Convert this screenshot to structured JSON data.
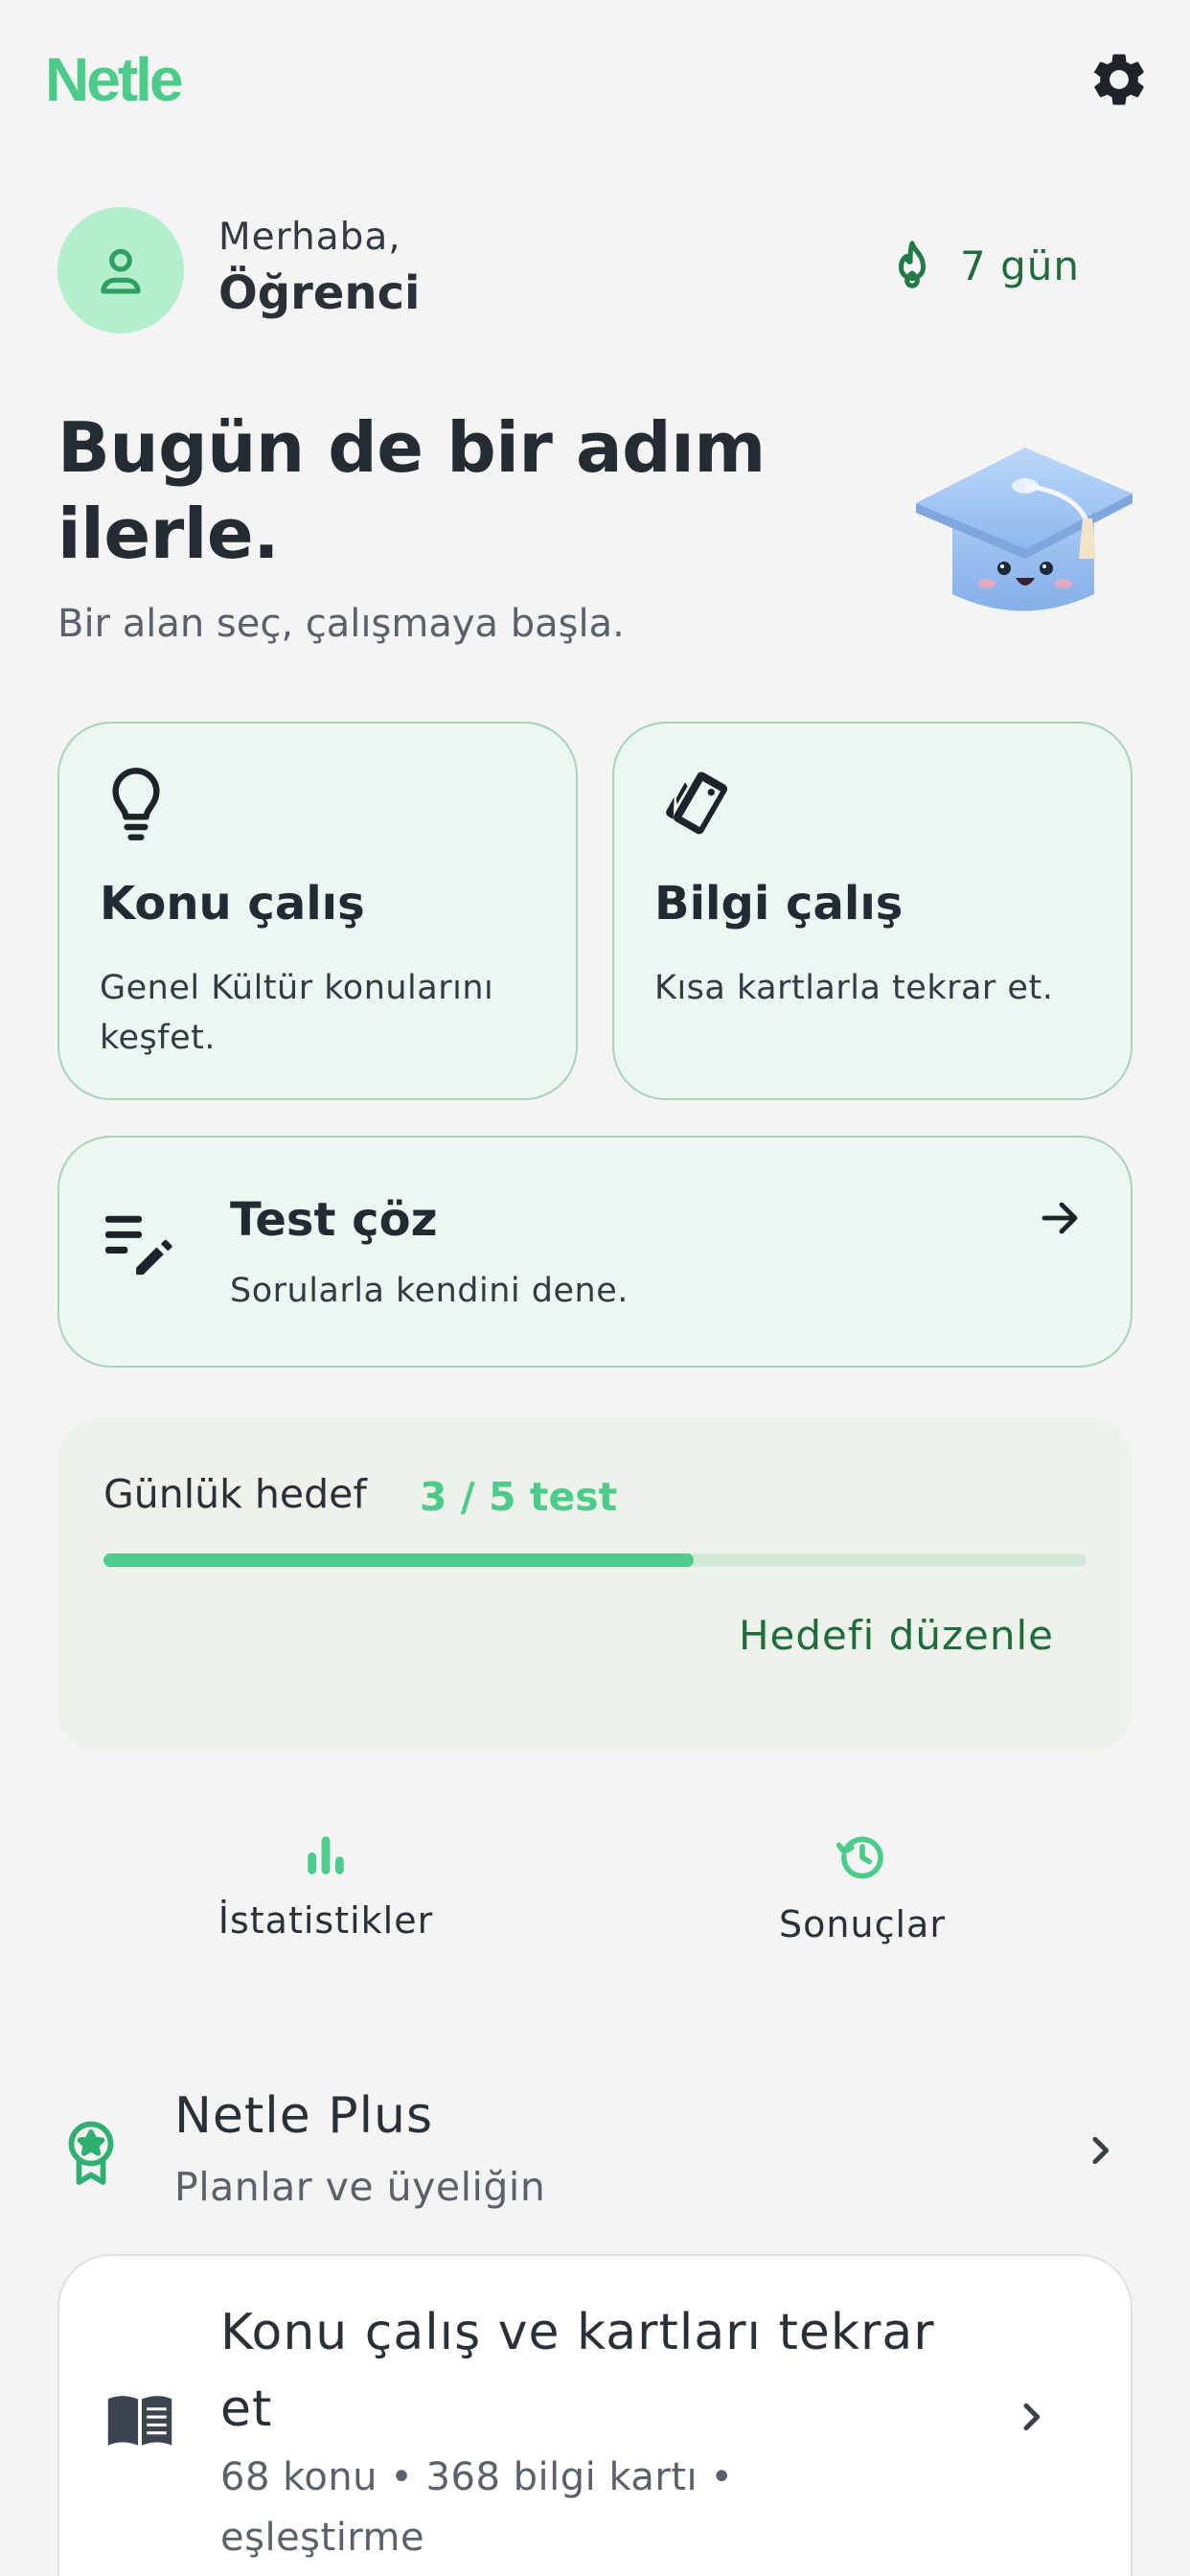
{
  "header": {
    "logo": "Netle",
    "settings_icon": "gear-icon"
  },
  "user": {
    "greeting": "Merhaba,",
    "name": "Öğrenci",
    "avatar_icon": "person-icon"
  },
  "streak": {
    "icon": "flame-icon",
    "label": "7 gün"
  },
  "hero": {
    "headline": "Bugün de bir adım ilerle.",
    "subtitle": "Bir alan seç, çalışmaya başla.",
    "mascot": "graduation-cap-mascot"
  },
  "cards": {
    "konu": {
      "icon": "lightbulb-icon",
      "title": "Konu çalış",
      "desc": "Genel Kültür konularını keşfet."
    },
    "bilgi": {
      "icon": "flashcards-icon",
      "title": "Bilgi çalış",
      "desc": "Kısa kartlarla tekrar et."
    },
    "test": {
      "icon": "edit-list-icon",
      "title": "Test çöz",
      "desc": "Sorularla kendini dene.",
      "arrow_icon": "arrow-right-icon"
    }
  },
  "goal": {
    "label": "Günlük hedef",
    "value": "3 / 5 test",
    "done": 3,
    "total": 5,
    "edit_label": "Hedefi düzenle"
  },
  "quick_links": [
    {
      "icon": "bar-chart-icon",
      "label": "İstatistikler"
    },
    {
      "icon": "history-icon",
      "label": "Sonuçlar"
    }
  ],
  "plus": {
    "icon": "award-badge-icon",
    "title": "Netle Plus",
    "subtitle": "Planlar ve üyeliğin"
  },
  "library": {
    "icon": "book-icon",
    "title": "Konu çalış ve kartları tekrar et",
    "subtitle": "68 konu • 368 bilgi kartı • eşleştirme"
  },
  "colors": {
    "accent": "#4ccb8a",
    "dark_green": "#1f6b3c",
    "card_bg": "#eaf8f1",
    "card_border": "#a9d2bc",
    "background": "#f4f4f4"
  }
}
